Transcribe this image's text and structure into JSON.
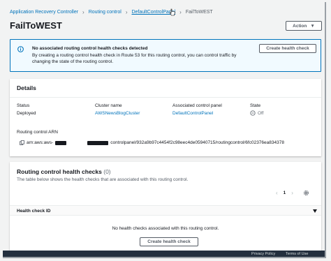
{
  "breadcrumb": {
    "items": [
      {
        "label": "Application Recovery Controller"
      },
      {
        "label": "Routing control"
      },
      {
        "label": "DefaultControlPanel"
      },
      {
        "label": "FailToWEST"
      }
    ]
  },
  "page": {
    "title": "FailToWEST",
    "action_label": "Action"
  },
  "alert": {
    "title": "No associated routing control health checks detected",
    "text": "By creating a routing control health check in Route 53 for this routing control, you can control traffic by changing the state of the routing control.",
    "button_label": "Create health check"
  },
  "details": {
    "header": "Details",
    "status_label": "Status",
    "status_value": "Deployed",
    "cluster_label": "Cluster name",
    "cluster_value": "AWSNewsBlogCluster",
    "panel_label": "Associated control panel",
    "panel_value": "DefaultControlPanel",
    "state_label": "State",
    "state_value": "Off",
    "arn_label": "Routing control ARN",
    "arn_prefix": "arn:aws:aws-",
    "arn_suffix": "controlpanel/932a9b97c4454f2c98eec4de05940715/routingcontrol/6fc02376ea834378"
  },
  "health_checks": {
    "header": "Routing control health checks",
    "count": "(0)",
    "description": "The table below shows the health checks that are associated with this routing control.",
    "page_number": "1",
    "column_header": "Health check ID",
    "empty_text": "No health checks associated with this routing control.",
    "button_label": "Create health check"
  },
  "footer": {
    "items": [
      "Privacy Policy",
      "Terms of Use"
    ]
  },
  "colors": {
    "link": "#0073bb",
    "alert_bg": "#f1faff",
    "footer_bg": "#232f3e"
  }
}
